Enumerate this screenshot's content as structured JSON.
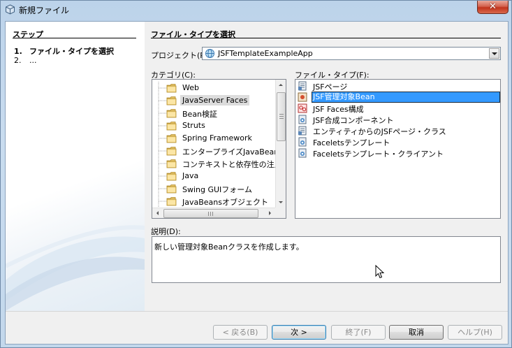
{
  "window": {
    "title": "新規ファイル"
  },
  "steps": {
    "title": "ステップ",
    "items": [
      {
        "num": "1.",
        "label": "ファイル・タイプを選択"
      },
      {
        "num": "2.",
        "label": "..."
      }
    ]
  },
  "main": {
    "title": "ファイル・タイプを選択",
    "project_label": "プロジェクト(P):",
    "project_value": "JSFTemplateExampleApp",
    "categories_label": "カテゴリ(C):",
    "categories": [
      "Web",
      "JavaServer Faces",
      "Bean検証",
      "Struts",
      "Spring Framework",
      "エンタープライズJavaBeans",
      "コンテキストと依存性の注入",
      "Java",
      "Swing GUIフォーム",
      "JavaBeansオブジェクト"
    ],
    "selected_category": "JavaServer Faces",
    "file_types_label": "ファイル・タイプ(F):",
    "file_types": [
      "JSFページ",
      "JSF管理対象Bean",
      "JSF Faces構成",
      "JSF合成コンポーネント",
      "エンティティからのJSFページ・クラス",
      "Faceletsテンプレート",
      "Faceletsテンプレート・クライアント"
    ],
    "selected_file_type": "JSF管理対象Bean",
    "description_label": "説明(D):",
    "description_text": "新しい管理対象Beanクラスを作成します。"
  },
  "buttons": {
    "back": "< 戻る(B)",
    "next": "次 >",
    "finish": "終了(F)",
    "cancel": "取消",
    "help": "ヘルプ(H)"
  },
  "scrollbar_grip": "Ⅲ",
  "colors": {
    "selection": "#3399ff",
    "title_bar": "#bcd3ea",
    "close_button": "#c1331c"
  }
}
